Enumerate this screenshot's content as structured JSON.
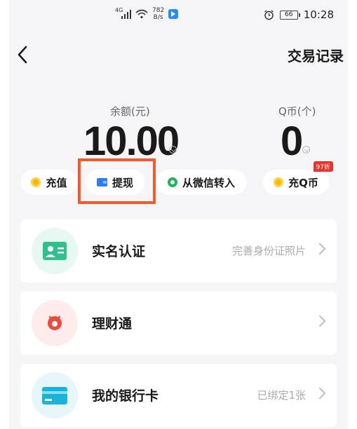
{
  "status_bar": {
    "network_tag": "4G",
    "speed_value": "782",
    "speed_unit": "B/s",
    "battery": "66",
    "time": "10:28"
  },
  "nav": {
    "back_icon": "chevron-left-icon",
    "right_action": "交易记录"
  },
  "balance": {
    "label": "余额(元)",
    "value": "10.00"
  },
  "qcoin": {
    "label": "Q币(个)",
    "value": "0"
  },
  "actions": [
    {
      "label": "充值",
      "icon": "coin-icon",
      "color": "#f5b800"
    },
    {
      "label": "提现",
      "icon": "wallet-icon",
      "color": "#2d7cf6"
    },
    {
      "label": "从微信转入",
      "icon": "wechat-icon",
      "color": "#1fb35a"
    },
    {
      "label": "充Q币",
      "icon": "coin-icon",
      "color": "#f5b800",
      "badge": "97折"
    }
  ],
  "highlight_color": "#f25c2c",
  "list": [
    {
      "label": "实名认证",
      "hint": "完善身份证照片",
      "icon": "id-card-icon",
      "icon_bg": "#e7f7f1"
    },
    {
      "label": "理财通",
      "hint": "",
      "icon": "licaitong-icon",
      "icon_bg": "#fdeceb"
    },
    {
      "label": "我的银行卡",
      "hint": "已绑定1张",
      "icon": "bank-card-icon",
      "icon_bg": "#e6f6fb"
    }
  ]
}
